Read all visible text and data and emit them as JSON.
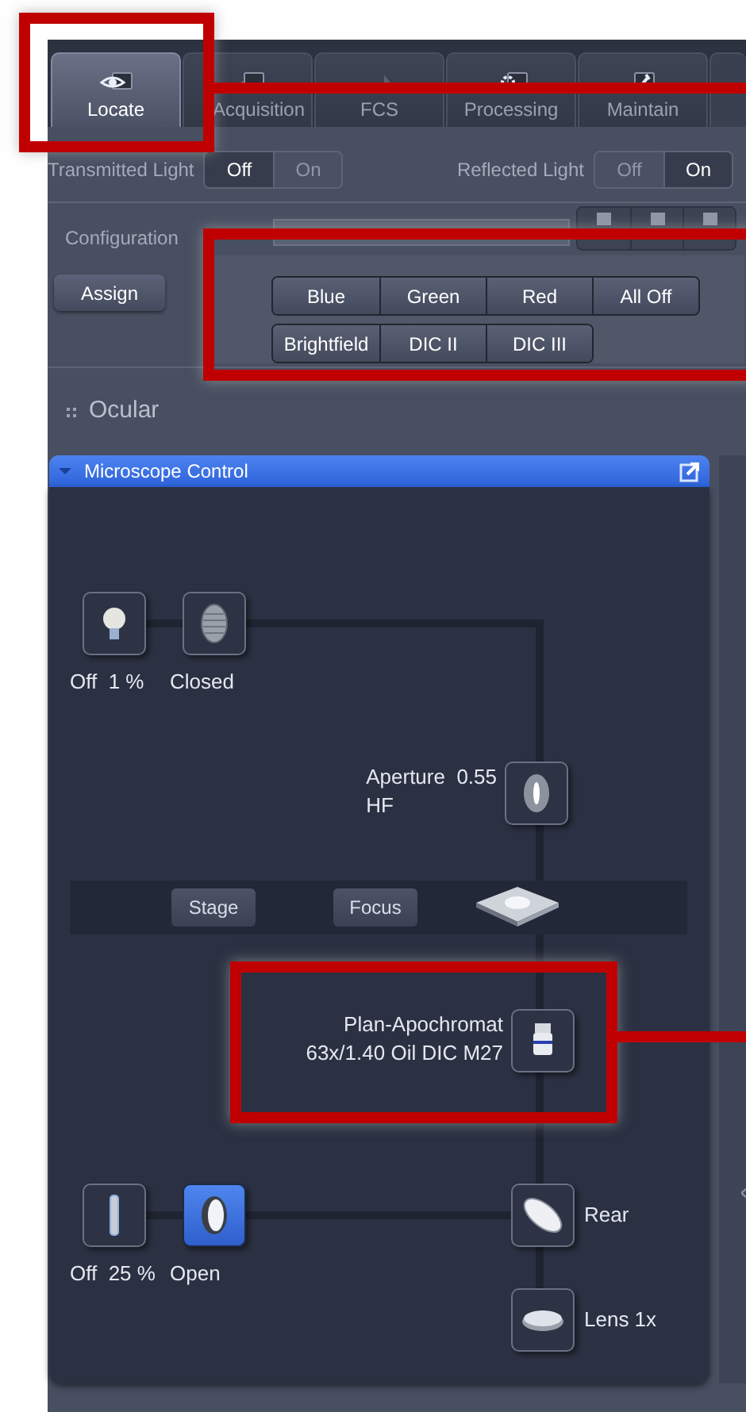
{
  "tabs": [
    {
      "label": "Locate",
      "selected": true
    },
    {
      "label": "Acquisition",
      "selected": false
    },
    {
      "label": "FCS",
      "selected": false
    },
    {
      "label": "Processing",
      "selected": false
    },
    {
      "label": "Maintain",
      "selected": false
    }
  ],
  "light_toggles": [
    {
      "label": "Transmitted Light",
      "options": [
        {
          "label": "Off",
          "selected": true
        },
        {
          "label": "On",
          "selected": false
        }
      ]
    },
    {
      "label": "Reflected Light",
      "options": [
        {
          "label": "Off",
          "selected": false
        },
        {
          "label": "On",
          "selected": true
        }
      ]
    }
  ],
  "configuration": {
    "label": "Configuration",
    "assign_button": "Assign"
  },
  "channel_buttons": [
    [
      "Blue",
      "Green",
      "Red",
      "All Off"
    ],
    [
      "Brightfield",
      "DIC II",
      "DIC III"
    ]
  ],
  "ocular_section": {
    "title": "Ocular"
  },
  "microscope_control": {
    "title": "Microscope Control",
    "expanded": true,
    "nodes": [
      {
        "kind": "lamp",
        "label": "Off  1 %",
        "active": false
      },
      {
        "kind": "shutter",
        "label": "Closed",
        "active": false
      },
      {
        "kind": "aperture",
        "label": "Aperture  0.55",
        "sublabel": "HF",
        "active": false
      },
      {
        "kind": "objective",
        "label": "Plan-Apochromat",
        "sublabel": "63x/1.40 Oil DIC M27",
        "active": false
      },
      {
        "kind": "filter",
        "label": "Off  25 %",
        "active": false
      },
      {
        "kind": "shutter",
        "label": "Open",
        "active": true
      },
      {
        "kind": "mirror",
        "label": "Rear",
        "active": false
      },
      {
        "kind": "lens",
        "label": "Lens 1x",
        "active": false
      }
    ],
    "stage_buttons": [
      "Stage",
      "Focus"
    ]
  }
}
